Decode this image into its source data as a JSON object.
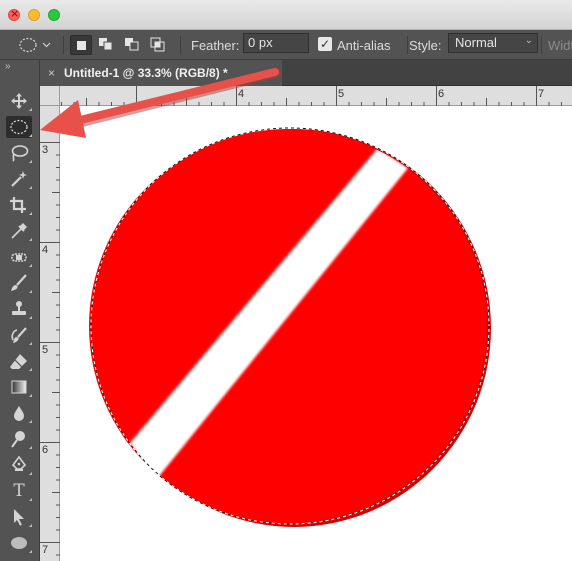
{
  "window": {
    "traffic_lights": [
      "close",
      "minimize",
      "maximize"
    ]
  },
  "options_bar": {
    "feather_label": "Feather:",
    "feather_value": "0 px",
    "antialias_label": "Anti-alias",
    "antialias_checked": true,
    "style_label": "Style:",
    "style_value": "Normal",
    "width_label": "Widt"
  },
  "document_tab": {
    "close_glyph": "×",
    "title": "Untitled-1 @ 33.3% (RGB/8) *"
  },
  "rulers": {
    "top": [
      "4",
      "5",
      "6",
      "7"
    ],
    "left": [
      "3",
      "4",
      "5",
      "6",
      "7"
    ]
  },
  "toolbar": {
    "collapse_glyph": "»",
    "tools": [
      {
        "name": "move-tool",
        "icon": "move-icon"
      },
      {
        "name": "elliptical-marquee-tool",
        "icon": "ellipse-marquee-icon",
        "active": true
      },
      {
        "name": "lasso-tool",
        "icon": "lasso-icon"
      },
      {
        "name": "magic-wand-tool",
        "icon": "magic-wand-icon"
      },
      {
        "name": "crop-tool",
        "icon": "crop-icon"
      },
      {
        "name": "eyedropper-tool",
        "icon": "eyedropper-icon"
      },
      {
        "name": "spot-healing-tool",
        "icon": "bandage-icon"
      },
      {
        "name": "brush-tool",
        "icon": "brush-icon"
      },
      {
        "name": "clone-stamp-tool",
        "icon": "stamp-icon"
      },
      {
        "name": "history-brush-tool",
        "icon": "history-brush-icon"
      },
      {
        "name": "eraser-tool",
        "icon": "eraser-icon"
      },
      {
        "name": "gradient-tool",
        "icon": "gradient-icon"
      },
      {
        "name": "blur-tool",
        "icon": "drop-icon"
      },
      {
        "name": "dodge-tool",
        "icon": "dodge-icon"
      },
      {
        "name": "pen-tool",
        "icon": "pen-icon"
      },
      {
        "name": "type-tool",
        "icon": "type-icon",
        "glyph": "T"
      },
      {
        "name": "path-selection-tool",
        "icon": "arrow-cursor-icon"
      },
      {
        "name": "ellipse-shape-tool",
        "icon": "ellipse-shape-icon"
      }
    ]
  },
  "colors": {
    "annotation_arrow": "#e8504a",
    "circle_fill": "#ff0000",
    "circle_rim": "#e10000",
    "stripe": "#ffffff"
  }
}
